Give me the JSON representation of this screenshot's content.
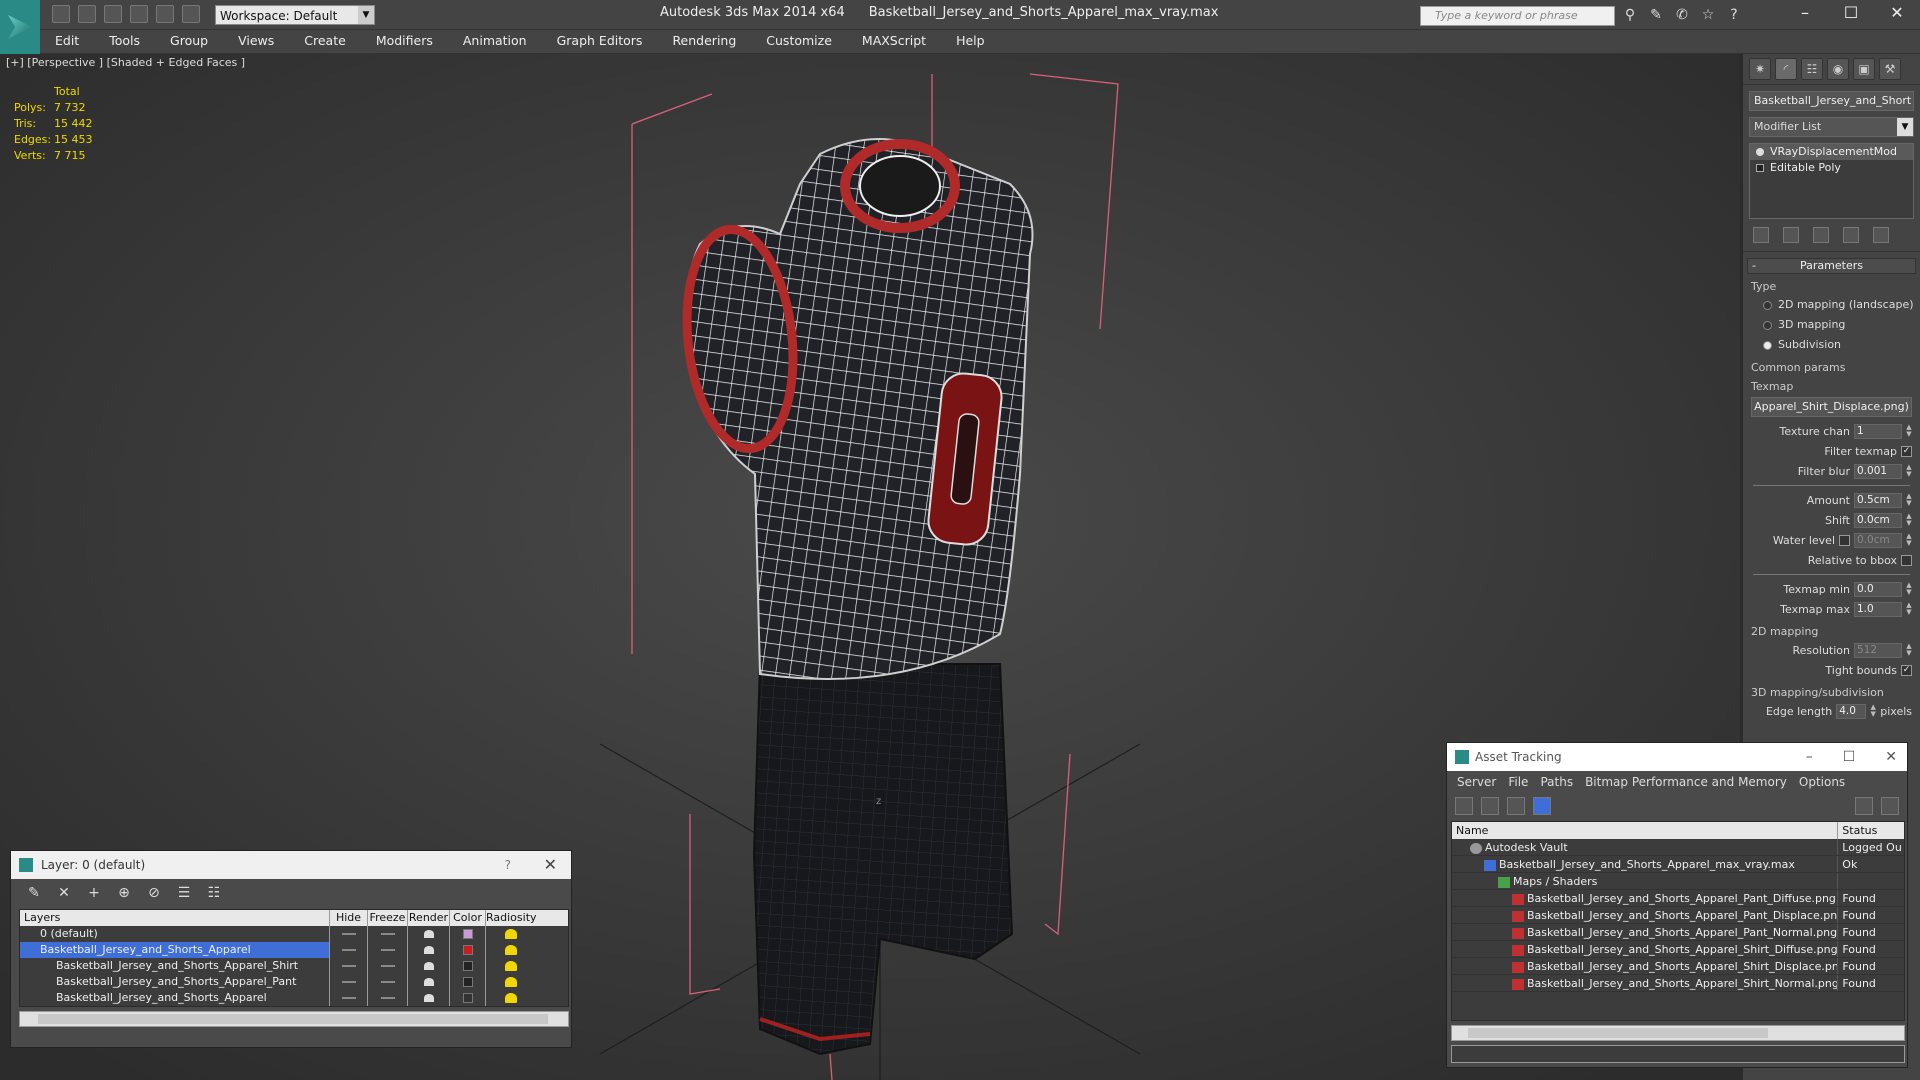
{
  "titlebar": {
    "app": "Autodesk 3ds Max  2014 x64",
    "file": "Basketball_Jersey_and_Shorts_Apparel_max_vray.max",
    "workspace": "Workspace: Default",
    "search_placeholder": "Type a keyword or phrase"
  },
  "menu": [
    "Edit",
    "Tools",
    "Group",
    "Views",
    "Create",
    "Modifiers",
    "Animation",
    "Graph Editors",
    "Rendering",
    "Customize",
    "MAXScript",
    "Help"
  ],
  "viewport": {
    "label": "[+] [Perspective ] [Shaded + Edged Faces ]",
    "stats": {
      "header": "Total",
      "rows": [
        {
          "k": "Polys:",
          "v": "7 732"
        },
        {
          "k": "Tris:",
          "v": "15 442"
        },
        {
          "k": "Edges:",
          "v": "15 453"
        },
        {
          "k": "Verts:",
          "v": "7 715"
        }
      ]
    }
  },
  "command_panel": {
    "object_name": "Basketball_Jersey_and_Short",
    "modifier_list": "Modifier List",
    "stack": [
      "VRayDisplacementMod",
      "Editable Poly"
    ],
    "parameters_title": "Parameters",
    "type_label": "Type",
    "type_options": [
      "2D mapping (landscape)",
      "3D mapping",
      "Subdivision"
    ],
    "common_params": "Common params",
    "texmap_label": "Texmap",
    "texmap_value": "Apparel_Shirt_Displace.png)",
    "texture_chan_label": "Texture chan",
    "texture_chan": "1",
    "filter_texmap_label": "Filter texmap",
    "filter_blur_label": "Filter blur",
    "filter_blur": "0.001",
    "amount_label": "Amount",
    "amount": "0.5cm",
    "shift_label": "Shift",
    "shift": "0.0cm",
    "water_level_label": "Water level",
    "water_level": "0.0cm",
    "relative_bbox_label": "Relative to bbox",
    "texmap_min_label": "Texmap min",
    "texmap_min": "0.0",
    "texmap_max_label": "Texmap max",
    "texmap_max": "1.0",
    "mapping_2d": "2D mapping",
    "resolution_label": "Resolution",
    "resolution": "512",
    "tight_bounds_label": "Tight bounds",
    "mapping_3d": "3D mapping/subdivision",
    "edge_length_label": "Edge length",
    "edge_length": "4.0",
    "pixels_label": "pixels"
  },
  "layer_window": {
    "title": "Layer: 0 (default)",
    "help": "?",
    "columns": [
      "Layers",
      "Hide",
      "Freeze",
      "Render",
      "Color",
      "Radiosity"
    ],
    "rows": [
      {
        "name": "0 (default)",
        "color": "#c99ad8"
      },
      {
        "name": "Basketball_Jersey_and_Shorts_Apparel",
        "color": "#c82020"
      },
      {
        "name": "Basketball_Jersey_and_Shorts_Apparel_Shirt",
        "color": "#222222"
      },
      {
        "name": "Basketball_Jersey_and_Shorts_Apparel_Pant",
        "color": "#222222"
      },
      {
        "name": "Basketball_Jersey_and_Shorts_Apparel",
        "color": "#333333"
      }
    ]
  },
  "asset_window": {
    "title": "Asset Tracking",
    "menu": [
      "Server",
      "File",
      "Paths",
      "Bitmap Performance and Memory",
      "Options"
    ],
    "columns": [
      "Name",
      "Status"
    ],
    "rows": [
      {
        "name": "Autodesk Vault",
        "status": "Logged Ou",
        "indent": 1,
        "icon": "vault"
      },
      {
        "name": "Basketball_Jersey_and_Shorts_Apparel_max_vray.max",
        "status": "Ok",
        "indent": 2,
        "icon": "file"
      },
      {
        "name": "Maps / Shaders",
        "status": "",
        "indent": 3,
        "icon": "maps"
      },
      {
        "name": "Basketball_Jersey_and_Shorts_Apparel_Pant_Diffuse.png",
        "status": "Found",
        "indent": 4,
        "icon": "png"
      },
      {
        "name": "Basketball_Jersey_and_Shorts_Apparel_Pant_Displace.png",
        "status": "Found",
        "indent": 4,
        "icon": "png"
      },
      {
        "name": "Basketball_Jersey_and_Shorts_Apparel_Pant_Normal.png",
        "status": "Found",
        "indent": 4,
        "icon": "png"
      },
      {
        "name": "Basketball_Jersey_and_Shorts_Apparel_Shirt_Diffuse.png",
        "status": "Found",
        "indent": 4,
        "icon": "png"
      },
      {
        "name": "Basketball_Jersey_and_Shorts_Apparel_Shirt_Displace.png",
        "status": "Found",
        "indent": 4,
        "icon": "png"
      },
      {
        "name": "Basketball_Jersey_and_Shorts_Apparel_Shirt_Normal.png",
        "status": "Found",
        "indent": 4,
        "icon": "png"
      }
    ]
  }
}
